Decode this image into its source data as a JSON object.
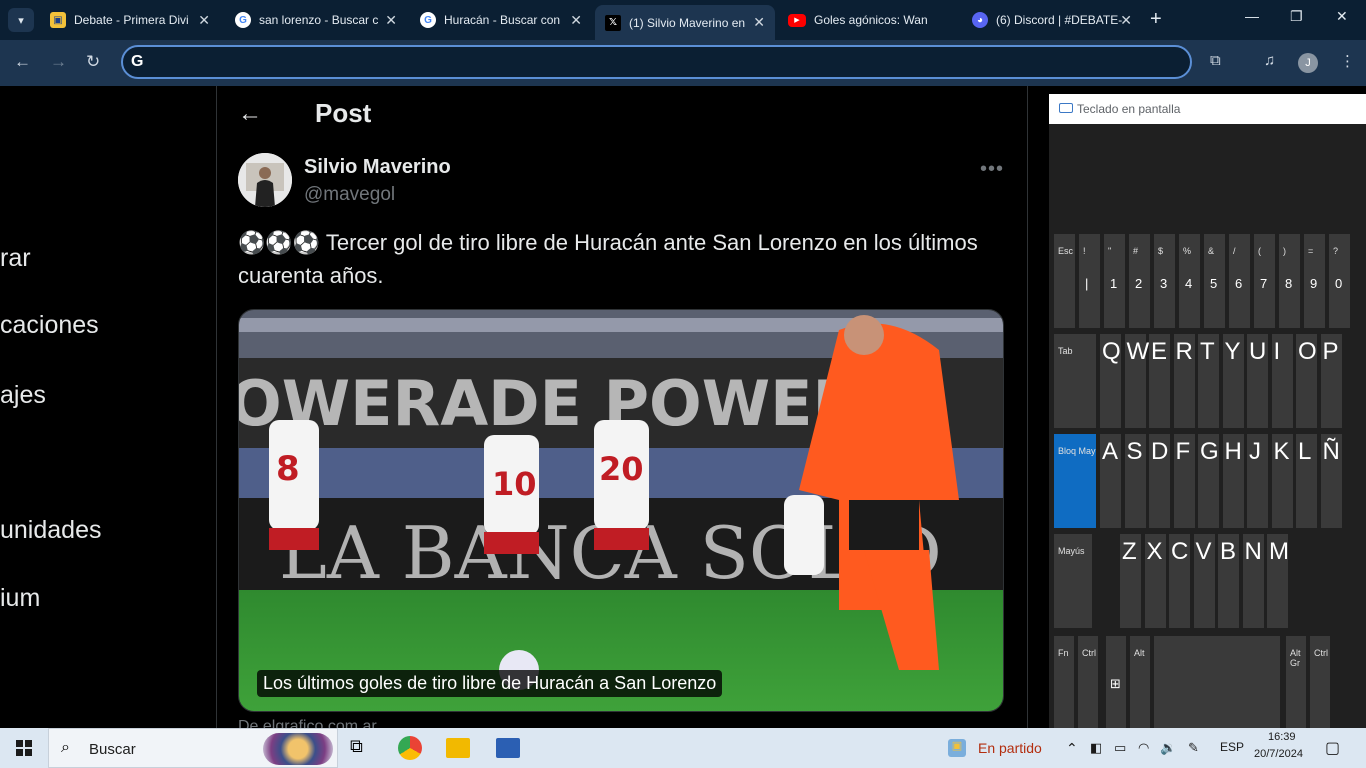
{
  "browser": {
    "tabs": [
      {
        "title": "Debate - Primera Divi",
        "icon": "argentina-badge-icon"
      },
      {
        "title": "san lorenzo - Buscar c",
        "icon": "google-icon"
      },
      {
        "title": "Huracán - Buscar con",
        "icon": "google-icon"
      },
      {
        "title": "(1) Silvio Maverino en",
        "icon": "x-icon",
        "active": true
      },
      {
        "title": "Goles agónicos: Wan",
        "icon": "youtube-icon"
      },
      {
        "title": "(6) Discord | #DEBATE-",
        "icon": "discord-icon"
      }
    ],
    "omnibox_value": "",
    "avatar_letter": "J"
  },
  "sidebar": {
    "items": [
      "rar",
      "caciones",
      "ajes",
      "unidades",
      "ium"
    ]
  },
  "post": {
    "header_title": "Post",
    "author_name": "Silvio Maverino",
    "author_handle": "@mavegol",
    "text": "⚽⚽⚽ Tercer gol de tiro libre de Huracán ante San Lorenzo en los últimos cuarenta años.",
    "image_caption": "Los últimos goles de tiro libre de Huracán a San Lorenzo",
    "source": "De elgrafico.com.ar"
  },
  "keyboard": {
    "title": "Teclado en pantalla",
    "row1": [
      {
        "top": "Esc"
      },
      {
        "top": "!",
        "main": "|"
      },
      {
        "top": "\"",
        "main": "1"
      },
      {
        "top": "#",
        "main": "2"
      },
      {
        "top": "$",
        "main": "3"
      },
      {
        "top": "%",
        "main": "4"
      },
      {
        "top": "&",
        "main": "5"
      },
      {
        "top": "/",
        "main": "6"
      },
      {
        "top": "(",
        "main": "7"
      },
      {
        "top": ")",
        "main": "8"
      },
      {
        "top": "=",
        "main": "9"
      },
      {
        "top": "?",
        "main": "0"
      }
    ],
    "row2": [
      "Tab",
      "Q",
      "W",
      "E",
      "R",
      "T",
      "Y",
      "U",
      "I",
      "O",
      "P"
    ],
    "row3": [
      "Bloq May",
      "A",
      "S",
      "D",
      "F",
      "G",
      "H",
      "J",
      "K",
      "L",
      "Ñ"
    ],
    "row4": [
      "Mayús",
      "Z",
      "X",
      "C",
      "V",
      "B",
      "N",
      "M"
    ],
    "row5": [
      "Fn",
      "Ctrl",
      "Alt",
      "Alt Gr",
      "Ctrl"
    ]
  },
  "taskbar": {
    "search_label": "Buscar",
    "weather_text": "En partido",
    "language": "ESP",
    "time": "16:39",
    "date": "20/7/2024"
  }
}
